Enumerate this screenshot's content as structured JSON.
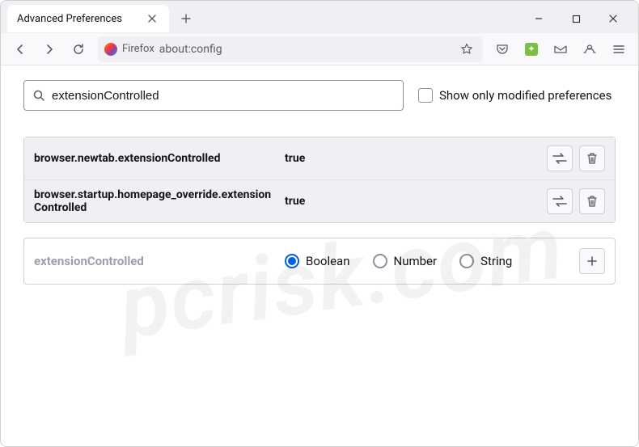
{
  "window": {
    "tab_title": "Advanced Preferences"
  },
  "toolbar": {
    "url_label": "Firefox",
    "url": "about:config"
  },
  "config": {
    "search_value": "extensionControlled",
    "modified_only_label": "Show only modified preferences",
    "prefs": [
      {
        "name": "browser.newtab.extensionControlled",
        "value": "true"
      },
      {
        "name": "browser.startup.homepage_override.extensionControlled",
        "value": "true"
      }
    ],
    "add": {
      "name": "extensionControlled",
      "types": [
        "Boolean",
        "Number",
        "String"
      ],
      "selected": 0
    }
  },
  "watermark": "pcrisk.com"
}
